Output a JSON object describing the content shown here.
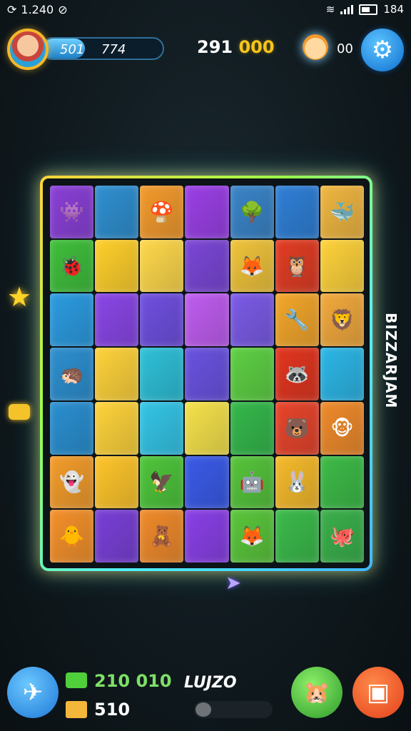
{
  "status_bar": {
    "time": "1.240",
    "battery": "184"
  },
  "hud": {
    "xp_left": "501",
    "xp_right": "774",
    "xp_progress": 0.35,
    "score_white": "291",
    "score_gold": "000",
    "creature_count": "00"
  },
  "board": {
    "tiles": [
      {
        "color": "#8a3fd6",
        "glyph": "👾"
      },
      {
        "color": "#2f8fd0",
        "glyph": ""
      },
      {
        "color": "#f39a2c",
        "glyph": "🍄"
      },
      {
        "color": "#9b3fe6",
        "glyph": ""
      },
      {
        "color": "#3a84c8",
        "glyph": "🌳"
      },
      {
        "color": "#2f7fd6",
        "glyph": ""
      },
      {
        "color": "#f0b640",
        "glyph": "🐳"
      },
      {
        "color": "#3fbf3a",
        "glyph": "🐞"
      },
      {
        "color": "#ffcf2a",
        "glyph": ""
      },
      {
        "color": "#ffd84a",
        "glyph": ""
      },
      {
        "color": "#7b46d6",
        "glyph": ""
      },
      {
        "color": "#f0c33a",
        "glyph": "🦊"
      },
      {
        "color": "#e23c22",
        "glyph": "🦉"
      },
      {
        "color": "#ffd23a",
        "glyph": ""
      },
      {
        "color": "#2b9be0",
        "glyph": ""
      },
      {
        "color": "#8a46e6",
        "glyph": ""
      },
      {
        "color": "#6f4fdf",
        "glyph": ""
      },
      {
        "color": "#c05cf0",
        "glyph": ""
      },
      {
        "color": "#7b5ae6",
        "glyph": ""
      },
      {
        "color": "#f4a62a",
        "glyph": "🔧"
      },
      {
        "color": "#f2a93c",
        "glyph": "🦁"
      },
      {
        "color": "#2d8fcf",
        "glyph": "🦔"
      },
      {
        "color": "#ffd23a",
        "glyph": ""
      },
      {
        "color": "#2ec0d8",
        "glyph": ""
      },
      {
        "color": "#6a52e0",
        "glyph": ""
      },
      {
        "color": "#5ed043",
        "glyph": ""
      },
      {
        "color": "#e2351e",
        "glyph": "🦝"
      },
      {
        "color": "#2cb6e6",
        "glyph": ""
      },
      {
        "color": "#2a8fd0",
        "glyph": ""
      },
      {
        "color": "#ffd33a",
        "glyph": ""
      },
      {
        "color": "#34c5e6",
        "glyph": ""
      },
      {
        "color": "#f6e24a",
        "glyph": ""
      },
      {
        "color": "#34b84a",
        "glyph": ""
      },
      {
        "color": "#e8442a",
        "glyph": "🐻"
      },
      {
        "color": "#ef8a2a",
        "glyph": "🐵"
      },
      {
        "color": "#f39c2a",
        "glyph": "👻"
      },
      {
        "color": "#ffc52a",
        "glyph": ""
      },
      {
        "color": "#4ec53a",
        "glyph": "🦅"
      },
      {
        "color": "#3a5ae8",
        "glyph": ""
      },
      {
        "color": "#56c43a",
        "glyph": "🤖"
      },
      {
        "color": "#f6ba2a",
        "glyph": "🐰"
      },
      {
        "color": "#3dbb46",
        "glyph": ""
      },
      {
        "color": "#f5902a",
        "glyph": "🐥"
      },
      {
        "color": "#7a3fd6",
        "glyph": ""
      },
      {
        "color": "#f08a2a",
        "glyph": "🧸"
      },
      {
        "color": "#8a3fe6",
        "glyph": ""
      },
      {
        "color": "#5ac63a",
        "glyph": "🦊"
      },
      {
        "color": "#3bbb4a",
        "glyph": ""
      },
      {
        "color": "#3ab04a",
        "glyph": "🐙"
      }
    ]
  },
  "side_label": "BIZZARJAM",
  "bottom": {
    "cash_value": "210 010",
    "box_value": "510",
    "mid_label": "LUJZO",
    "slider_level": 0.0
  },
  "colors": {
    "accent_blue": "#1e78d6",
    "gold": "#f6c51a",
    "board_glow": "#ffe46a"
  },
  "icons": {
    "avatar": "avatar-icon",
    "creature": "creature-icon",
    "settings": "gear-icon",
    "send": "send-icon",
    "pet": "pet-icon",
    "shop": "shop-icon"
  }
}
